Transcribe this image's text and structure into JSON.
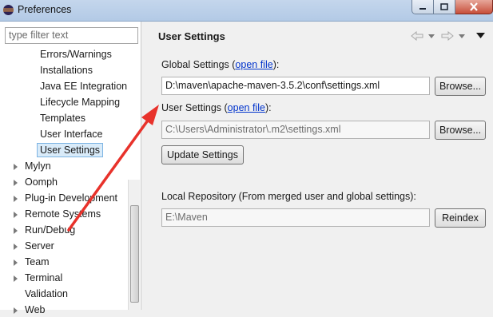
{
  "window": {
    "title": "Preferences"
  },
  "filter": {
    "placeholder": "type filter text"
  },
  "tree": {
    "children": [
      "Errors/Warnings",
      "Installations",
      "Java EE Integration",
      "Lifecycle Mapping",
      "Templates",
      "User Interface",
      "User Settings"
    ],
    "top_level": [
      "Mylyn",
      "Oomph",
      "Plug-in Development",
      "Remote Systems",
      "Run/Debug",
      "Server",
      "Team",
      "Terminal",
      "Validation",
      "Web"
    ]
  },
  "page": {
    "title": "User Settings"
  },
  "global_settings": {
    "label": "Global Settings (",
    "link": "open file",
    "label_end": "):",
    "value": "D:\\maven\\apache-maven-3.5.2\\conf\\settings.xml",
    "browse": "Browse..."
  },
  "user_settings": {
    "label": "User Settings (",
    "link": "open file",
    "label_end": "):",
    "value": "C:\\Users\\Administrator\\.m2\\settings.xml",
    "browse": "Browse..."
  },
  "update_button": "Update Settings",
  "local_repo": {
    "label": "Local Repository (From merged user and global settings):",
    "value": "E:\\Maven",
    "reindex": "Reindex"
  },
  "colors": {
    "annotation_arrow": "#e8322b",
    "link": "#0033cc",
    "selection": "#d9ebf9"
  }
}
